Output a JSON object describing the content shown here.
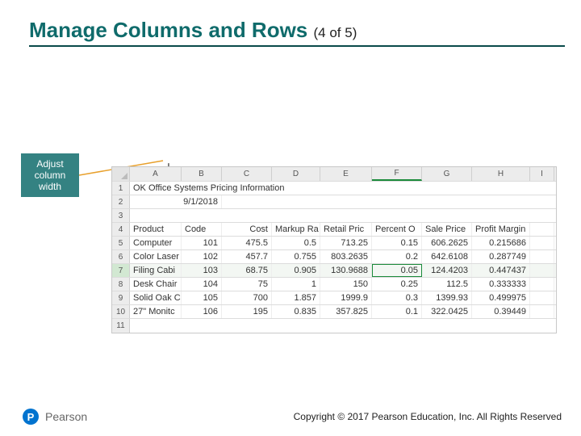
{
  "title": {
    "main": "Manage Columns and Rows",
    "suffix": "(4 of 5)"
  },
  "callout": {
    "text": "Adjust column width"
  },
  "sheet": {
    "col_letters": [
      "A",
      "B",
      "C",
      "D",
      "E",
      "F",
      "G",
      "H",
      "I"
    ],
    "row1_title": "OK Office Systems Pricing Information",
    "row2_date": "9/1/2018",
    "headers": {
      "product": "Product",
      "code": "Code",
      "cost": "Cost",
      "markup": "Markup Ra",
      "retail": "Retail Pric",
      "percentoff": "Percent O",
      "sale": "Sale Price",
      "margin": "Profit Margin"
    },
    "rows": [
      {
        "n": 5,
        "product": "Computer",
        "code": "101",
        "cost": "475.5",
        "markup": "0.5",
        "retail": "713.25",
        "percentoff": "0.15",
        "sale": "606.2625",
        "margin": "0.215686"
      },
      {
        "n": 6,
        "product": "Color Laser",
        "code": "102",
        "cost": "457.7",
        "markup": "0.755",
        "retail": "803.2635",
        "percentoff": "0.2",
        "sale": "642.6108",
        "margin": "0.287749"
      },
      {
        "n": 7,
        "product": "Filing Cabi",
        "code": "103",
        "cost": "68.75",
        "markup": "0.905",
        "retail": "130.9688",
        "percentoff": "0.05",
        "sale": "124.4203",
        "margin": "0.447437"
      },
      {
        "n": 8,
        "product": "Desk Chair",
        "code": "104",
        "cost": "75",
        "markup": "1",
        "retail": "150",
        "percentoff": "0.25",
        "sale": "112.5",
        "margin": "0.333333"
      },
      {
        "n": 9,
        "product": "Solid Oak C",
        "code": "105",
        "cost": "700",
        "markup": "1.857",
        "retail": "1999.9",
        "percentoff": "0.3",
        "sale": "1399.93",
        "margin": "0.499975"
      },
      {
        "n": 10,
        "product": "27\" Monitc",
        "code": "106",
        "cost": "195",
        "markup": "0.835",
        "retail": "357.825",
        "percentoff": "0.1",
        "sale": "322.0425",
        "margin": "0.39449"
      }
    ],
    "selected_cell": {
      "row": 7,
      "col": "F"
    },
    "resize_between": [
      "A",
      "B"
    ]
  },
  "footer": {
    "brand_letter": "P",
    "brand": "Pearson",
    "copyright": "Copyright © 2017 Pearson Education, Inc. All Rights Reserved"
  }
}
